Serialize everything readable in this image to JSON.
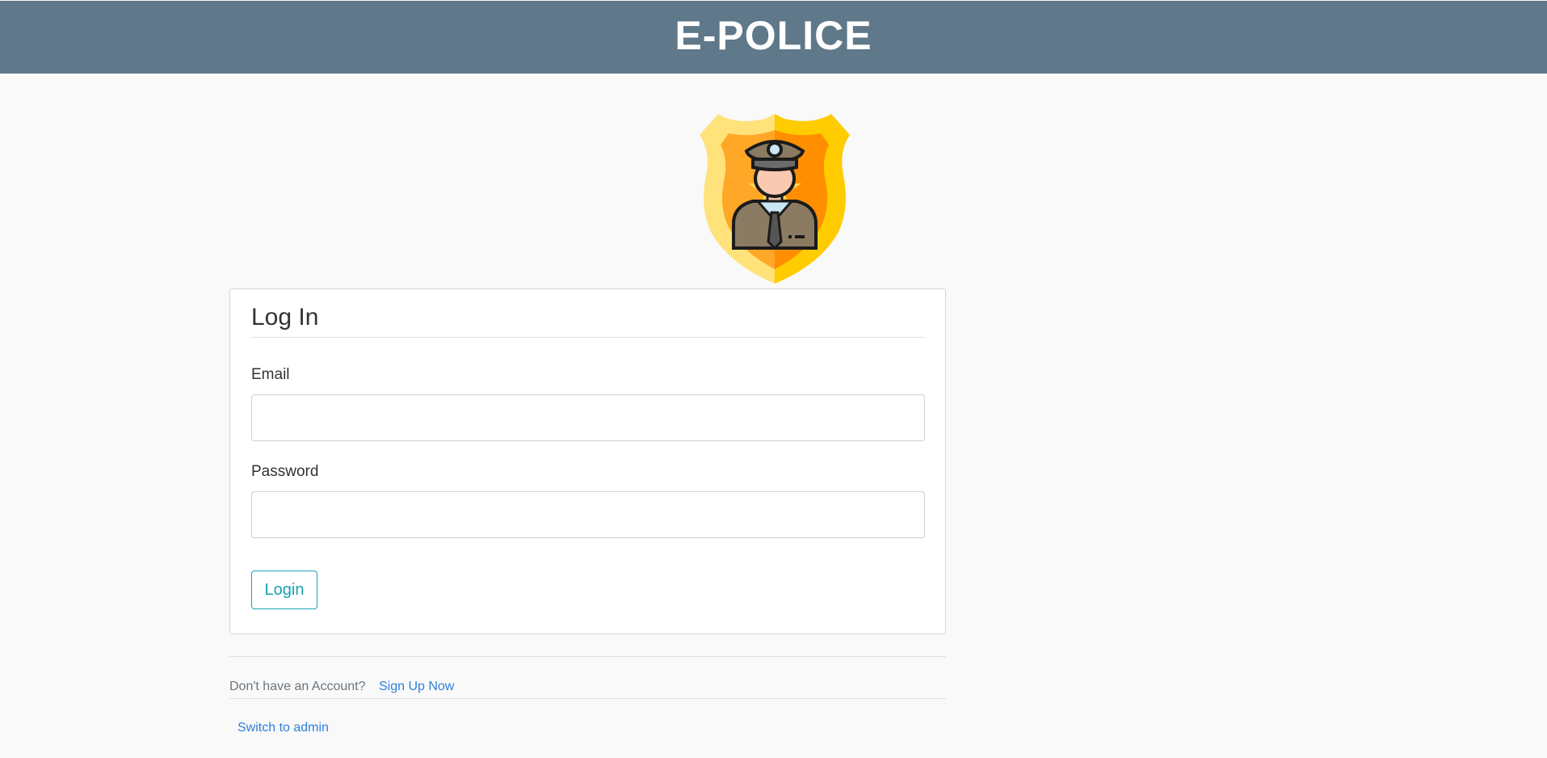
{
  "header": {
    "title": "E-POLICE"
  },
  "logo": {
    "icon": "police-officer-badge-icon",
    "colors": {
      "shield_outer": "#ffd54f",
      "shield_inner": "#ff9800",
      "uniform": "#8b7b62"
    }
  },
  "login_form": {
    "heading": "Log In",
    "email_label": "Email",
    "email_value": "",
    "email_placeholder": "",
    "password_label": "Password",
    "password_value": "",
    "password_placeholder": "",
    "submit_label": "Login"
  },
  "footer": {
    "signup_prompt": "Don't have an Account?",
    "signup_link": "Sign Up Now",
    "admin_link": "Switch to admin"
  },
  "colors": {
    "header_bg": "#5f788a",
    "accent": "#17a2b8",
    "link": "#2f7fd8"
  }
}
